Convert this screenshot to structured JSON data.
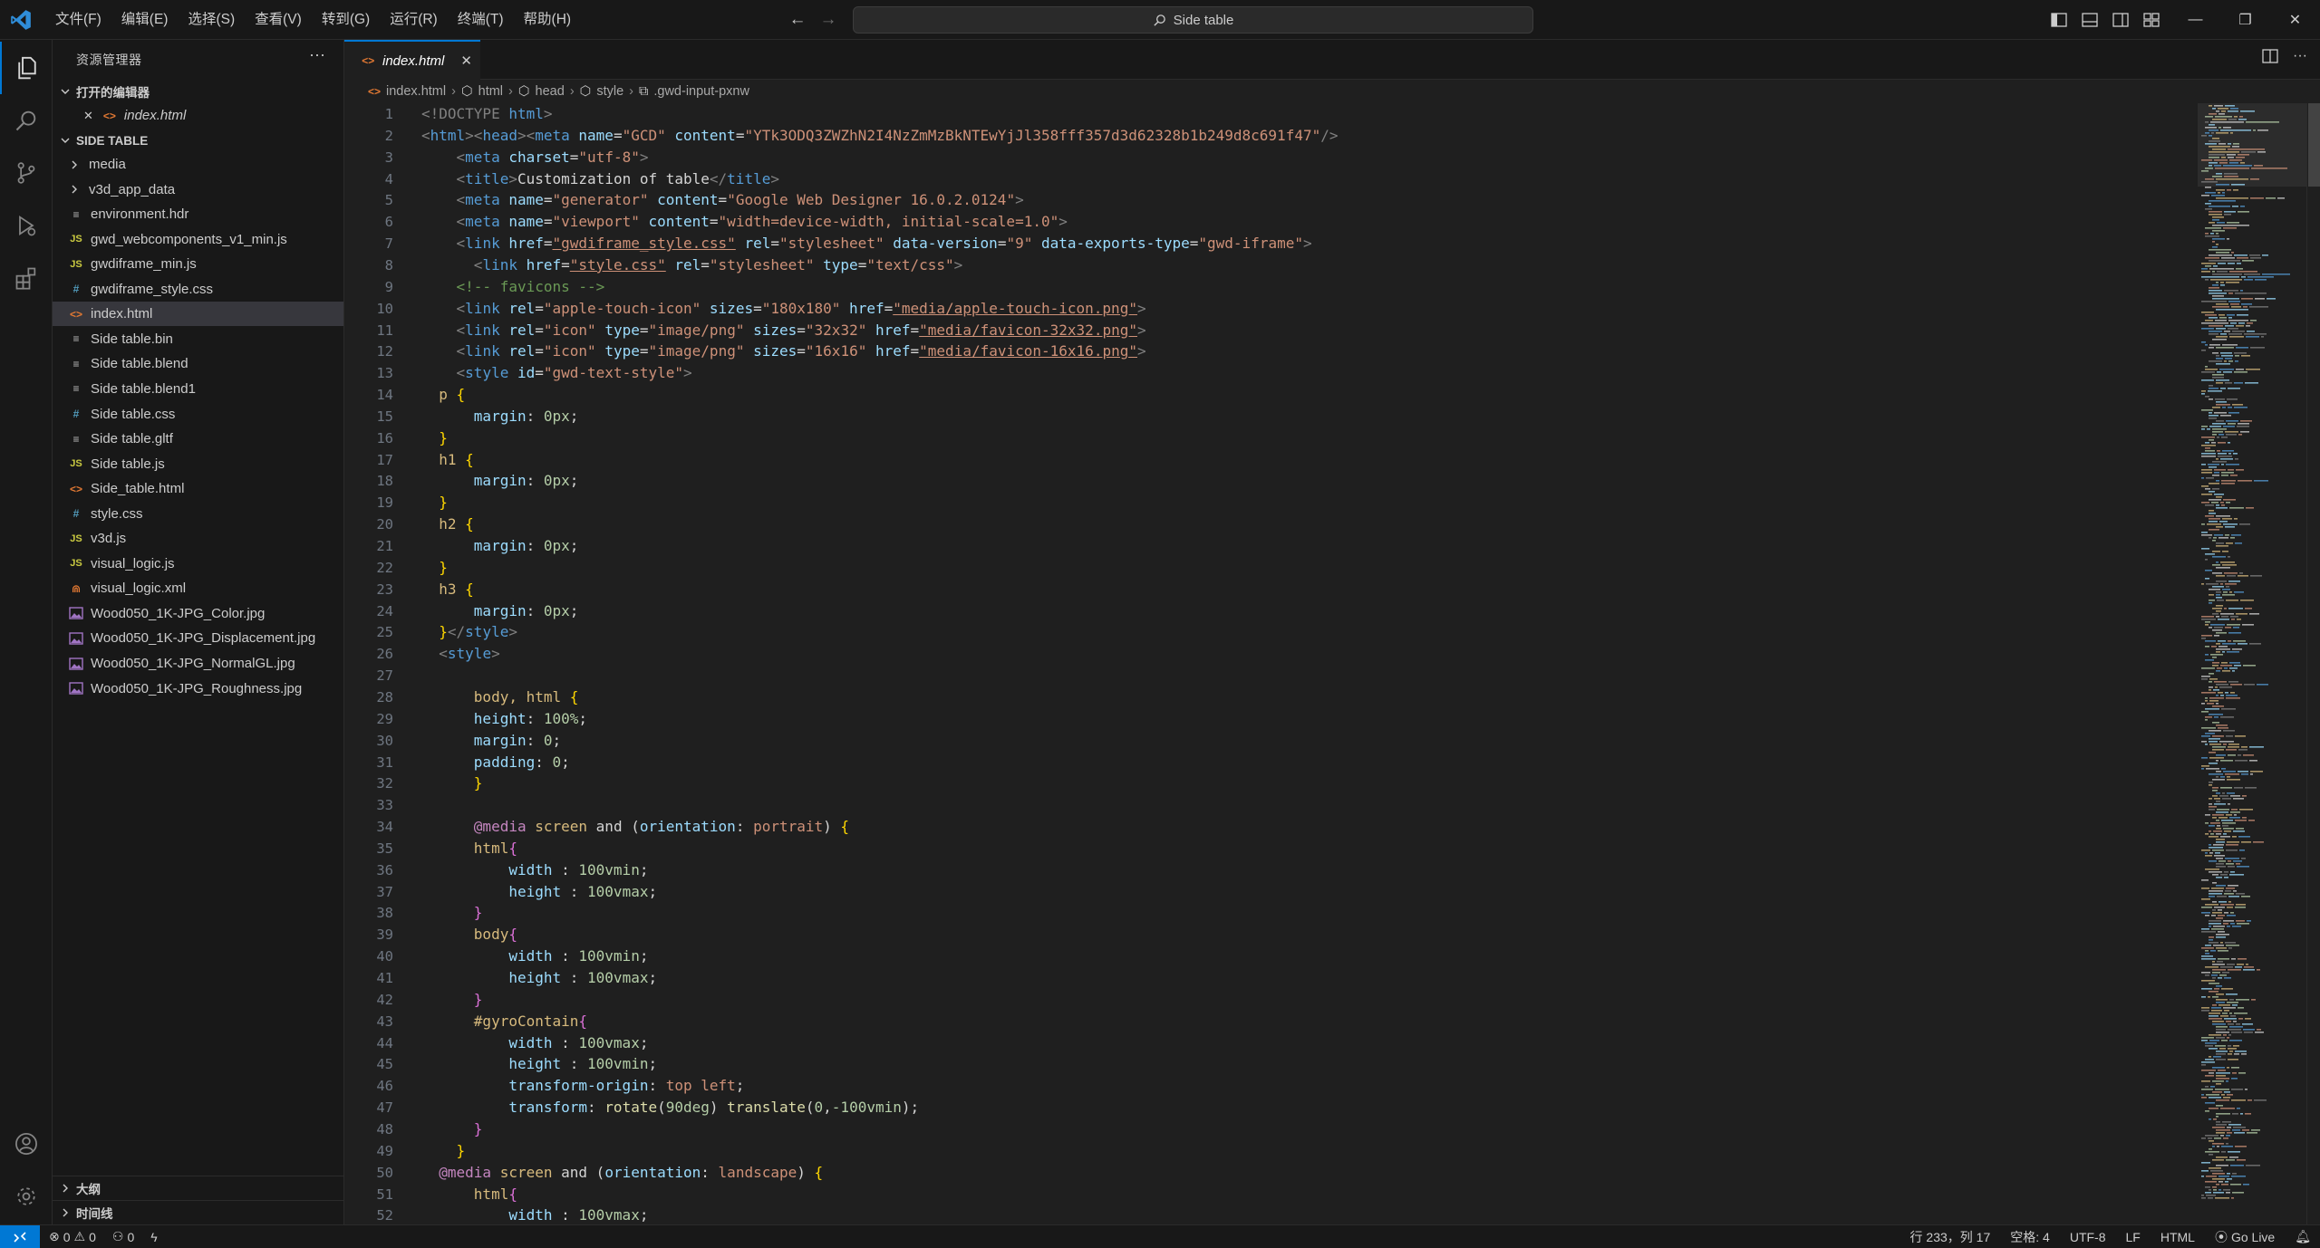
{
  "menu": [
    "文件(F)",
    "编辑(E)",
    "选择(S)",
    "查看(V)",
    "转到(G)",
    "运行(R)",
    "终端(T)",
    "帮助(H)"
  ],
  "search": {
    "text": "Side table"
  },
  "explorer": {
    "title": "资源管理器",
    "open_editors": {
      "title": "打开的编辑器",
      "items": [
        {
          "name": "index.html"
        }
      ]
    },
    "folder": {
      "title": "SIDE TABLE",
      "items": [
        {
          "name": "media",
          "type": "folder"
        },
        {
          "name": "v3d_app_data",
          "type": "folder"
        },
        {
          "name": "environment.hdr",
          "type": "file"
        },
        {
          "name": "gwd_webcomponents_v1_min.js",
          "type": "js"
        },
        {
          "name": "gwdiframe_min.js",
          "type": "js"
        },
        {
          "name": "gwdiframe_style.css",
          "type": "css"
        },
        {
          "name": "index.html",
          "type": "html",
          "selected": true
        },
        {
          "name": "Side table.bin",
          "type": "file"
        },
        {
          "name": "Side table.blend",
          "type": "file"
        },
        {
          "name": "Side table.blend1",
          "type": "file"
        },
        {
          "name": "Side table.css",
          "type": "css"
        },
        {
          "name": "Side table.gltf",
          "type": "file"
        },
        {
          "name": "Side table.js",
          "type": "js"
        },
        {
          "name": "Side_table.html",
          "type": "html"
        },
        {
          "name": "style.css",
          "type": "css"
        },
        {
          "name": "v3d.js",
          "type": "js"
        },
        {
          "name": "visual_logic.js",
          "type": "js"
        },
        {
          "name": "visual_logic.xml",
          "type": "xml"
        },
        {
          "name": "Wood050_1K-JPG_Color.jpg",
          "type": "image"
        },
        {
          "name": "Wood050_1K-JPG_Displacement.jpg",
          "type": "image"
        },
        {
          "name": "Wood050_1K-JPG_NormalGL.jpg",
          "type": "image"
        },
        {
          "name": "Wood050_1K-JPG_Roughness.jpg",
          "type": "image"
        }
      ]
    },
    "outline": {
      "title": "大纲"
    },
    "timeline": {
      "title": "时间线"
    }
  },
  "tab": {
    "label": "index.html"
  },
  "breadcrumb": [
    "index.html",
    "html",
    "head",
    "style",
    ".gwd-input-pxnw"
  ],
  "code_lines": [
    [
      [
        "<!DOCTYPE ",
        "#808080"
      ],
      [
        "html",
        "#569cd6"
      ],
      [
        ">",
        "#808080"
      ]
    ],
    [
      [
        "<",
        "#808080"
      ],
      [
        "html",
        "#569cd6"
      ],
      [
        "><",
        "#808080"
      ],
      [
        "head",
        "#569cd6"
      ],
      [
        "><",
        "#808080"
      ],
      [
        "meta ",
        "#569cd6"
      ],
      [
        "name",
        "#9cdcfe"
      ],
      [
        "=",
        "#d4d4d4"
      ],
      [
        "\"GCD\"",
        "#ce9178"
      ],
      [
        " content",
        "#9cdcfe"
      ],
      [
        "=",
        "#d4d4d4"
      ],
      [
        "\"YTk3ODQ3ZWZhN2I4NzZmMzBkNTEwYjJl358fff357d3d62328b1b249d8c691f47\"",
        "#ce9178"
      ],
      [
        "/>",
        "#808080"
      ]
    ],
    [
      [
        "    <",
        "#808080"
      ],
      [
        "meta ",
        "#569cd6"
      ],
      [
        "charset",
        "#9cdcfe"
      ],
      [
        "=",
        "#d4d4d4"
      ],
      [
        "\"utf-8\"",
        "#ce9178"
      ],
      [
        ">",
        "#808080"
      ]
    ],
    [
      [
        "    <",
        "#808080"
      ],
      [
        "title",
        "#569cd6"
      ],
      [
        ">",
        "#808080"
      ],
      [
        "Customization of table",
        "#d4d4d4"
      ],
      [
        "</",
        "#808080"
      ],
      [
        "title",
        "#569cd6"
      ],
      [
        ">",
        "#808080"
      ]
    ],
    [
      [
        "    <",
        "#808080"
      ],
      [
        "meta ",
        "#569cd6"
      ],
      [
        "name",
        "#9cdcfe"
      ],
      [
        "=",
        "#d4d4d4"
      ],
      [
        "\"generator\"",
        "#ce9178"
      ],
      [
        " content",
        "#9cdcfe"
      ],
      [
        "=",
        "#d4d4d4"
      ],
      [
        "\"Google Web Designer 16.0.2.0124\"",
        "#ce9178"
      ],
      [
        ">",
        "#808080"
      ]
    ],
    [
      [
        "    <",
        "#808080"
      ],
      [
        "meta ",
        "#569cd6"
      ],
      [
        "name",
        "#9cdcfe"
      ],
      [
        "=",
        "#d4d4d4"
      ],
      [
        "\"viewport\"",
        "#ce9178"
      ],
      [
        " content",
        "#9cdcfe"
      ],
      [
        "=",
        "#d4d4d4"
      ],
      [
        "\"width=device-width, initial-scale=1.0\"",
        "#ce9178"
      ],
      [
        ">",
        "#808080"
      ]
    ],
    [
      [
        "    <",
        "#808080"
      ],
      [
        "link ",
        "#569cd6"
      ],
      [
        "href",
        "#9cdcfe"
      ],
      [
        "=",
        "#d4d4d4"
      ],
      [
        "\"gwdiframe_style.css\"",
        "#ce9178"
      ],
      [
        " rel",
        "#9cdcfe"
      ],
      [
        "=",
        "#d4d4d4"
      ],
      [
        "\"stylesheet\"",
        "#ce9178"
      ],
      [
        " data-version",
        "#9cdcfe"
      ],
      [
        "=",
        "#d4d4d4"
      ],
      [
        "\"9\"",
        "#ce9178"
      ],
      [
        " data-exports-type",
        "#9cdcfe"
      ],
      [
        "=",
        "#d4d4d4"
      ],
      [
        "\"gwd-iframe\"",
        "#ce9178"
      ],
      [
        ">",
        "#808080"
      ]
    ],
    [
      [
        "      <",
        "#808080"
      ],
      [
        "link ",
        "#569cd6"
      ],
      [
        "href",
        "#9cdcfe"
      ],
      [
        "=",
        "#d4d4d4"
      ],
      [
        "\"style.css\"",
        "#ce9178"
      ],
      [
        " rel",
        "#9cdcfe"
      ],
      [
        "=",
        "#d4d4d4"
      ],
      [
        "\"stylesheet\"",
        "#ce9178"
      ],
      [
        " type",
        "#9cdcfe"
      ],
      [
        "=",
        "#d4d4d4"
      ],
      [
        "\"text/css\"",
        "#ce9178"
      ],
      [
        ">",
        "#808080"
      ]
    ],
    [
      [
        "    <!-- favicons -->",
        "#6a9955"
      ]
    ],
    [
      [
        "    <",
        "#808080"
      ],
      [
        "link ",
        "#569cd6"
      ],
      [
        "rel",
        "#9cdcfe"
      ],
      [
        "=",
        "#d4d4d4"
      ],
      [
        "\"apple-touch-icon\"",
        "#ce9178"
      ],
      [
        " sizes",
        "#9cdcfe"
      ],
      [
        "=",
        "#d4d4d4"
      ],
      [
        "\"180x180\"",
        "#ce9178"
      ],
      [
        " href",
        "#9cdcfe"
      ],
      [
        "=",
        "#d4d4d4"
      ],
      [
        "\"media/apple-touch-icon.png\"",
        "#ce9178"
      ],
      [
        ">",
        "#808080"
      ]
    ],
    [
      [
        "    <",
        "#808080"
      ],
      [
        "link ",
        "#569cd6"
      ],
      [
        "rel",
        "#9cdcfe"
      ],
      [
        "=",
        "#d4d4d4"
      ],
      [
        "\"icon\"",
        "#ce9178"
      ],
      [
        " type",
        "#9cdcfe"
      ],
      [
        "=",
        "#d4d4d4"
      ],
      [
        "\"image/png\"",
        "#ce9178"
      ],
      [
        " sizes",
        "#9cdcfe"
      ],
      [
        "=",
        "#d4d4d4"
      ],
      [
        "\"32x32\"",
        "#ce9178"
      ],
      [
        " href",
        "#9cdcfe"
      ],
      [
        "=",
        "#d4d4d4"
      ],
      [
        "\"media/favicon-32x32.png\"",
        "#ce9178"
      ],
      [
        ">",
        "#808080"
      ]
    ],
    [
      [
        "    <",
        "#808080"
      ],
      [
        "link ",
        "#569cd6"
      ],
      [
        "rel",
        "#9cdcfe"
      ],
      [
        "=",
        "#d4d4d4"
      ],
      [
        "\"icon\"",
        "#ce9178"
      ],
      [
        " type",
        "#9cdcfe"
      ],
      [
        "=",
        "#d4d4d4"
      ],
      [
        "\"image/png\"",
        "#ce9178"
      ],
      [
        " sizes",
        "#9cdcfe"
      ],
      [
        "=",
        "#d4d4d4"
      ],
      [
        "\"16x16\"",
        "#ce9178"
      ],
      [
        " href",
        "#9cdcfe"
      ],
      [
        "=",
        "#d4d4d4"
      ],
      [
        "\"media/favicon-16x16.png\"",
        "#ce9178"
      ],
      [
        ">",
        "#808080"
      ]
    ],
    [
      [
        "    <",
        "#808080"
      ],
      [
        "style ",
        "#569cd6"
      ],
      [
        "id",
        "#9cdcfe"
      ],
      [
        "=",
        "#d4d4d4"
      ],
      [
        "\"gwd-text-style\"",
        "#ce9178"
      ],
      [
        ">",
        "#808080"
      ]
    ],
    [
      [
        "  p ",
        "#d7ba7d"
      ],
      [
        "{",
        "#ffd700"
      ]
    ],
    [
      [
        "      margin",
        "#9cdcfe"
      ],
      [
        ": ",
        "#d4d4d4"
      ],
      [
        "0px",
        "#b5cea8"
      ],
      [
        ";",
        "#d4d4d4"
      ]
    ],
    [
      [
        "  }",
        "#ffd700"
      ]
    ],
    [
      [
        "  h1 ",
        "#d7ba7d"
      ],
      [
        "{",
        "#ffd700"
      ]
    ],
    [
      [
        "      margin",
        "#9cdcfe"
      ],
      [
        ": ",
        "#d4d4d4"
      ],
      [
        "0px",
        "#b5cea8"
      ],
      [
        ";",
        "#d4d4d4"
      ]
    ],
    [
      [
        "  }",
        "#ffd700"
      ]
    ],
    [
      [
        "  h2 ",
        "#d7ba7d"
      ],
      [
        "{",
        "#ffd700"
      ]
    ],
    [
      [
        "      margin",
        "#9cdcfe"
      ],
      [
        ": ",
        "#d4d4d4"
      ],
      [
        "0px",
        "#b5cea8"
      ],
      [
        ";",
        "#d4d4d4"
      ]
    ],
    [
      [
        "  }",
        "#ffd700"
      ]
    ],
    [
      [
        "  h3 ",
        "#d7ba7d"
      ],
      [
        "{",
        "#ffd700"
      ]
    ],
    [
      [
        "      margin",
        "#9cdcfe"
      ],
      [
        ": ",
        "#d4d4d4"
      ],
      [
        "0px",
        "#b5cea8"
      ],
      [
        ";",
        "#d4d4d4"
      ]
    ],
    [
      [
        "  }",
        "#ffd700"
      ],
      [
        "</",
        "#808080"
      ],
      [
        "style",
        "#569cd6"
      ],
      [
        ">",
        "#808080"
      ]
    ],
    [
      [
        "  <",
        "#808080"
      ],
      [
        "style",
        "#569cd6"
      ],
      [
        ">",
        "#808080"
      ]
    ],
    [
      [
        "",
        "#d4d4d4"
      ]
    ],
    [
      [
        "      body, html ",
        "#d7ba7d"
      ],
      [
        "{",
        "#ffd700"
      ]
    ],
    [
      [
        "      height",
        "#9cdcfe"
      ],
      [
        ": ",
        "#d4d4d4"
      ],
      [
        "100%",
        "#b5cea8"
      ],
      [
        ";",
        "#d4d4d4"
      ]
    ],
    [
      [
        "      margin",
        "#9cdcfe"
      ],
      [
        ": ",
        "#d4d4d4"
      ],
      [
        "0",
        "#b5cea8"
      ],
      [
        ";",
        "#d4d4d4"
      ]
    ],
    [
      [
        "      padding",
        "#9cdcfe"
      ],
      [
        ": ",
        "#d4d4d4"
      ],
      [
        "0",
        "#b5cea8"
      ],
      [
        ";",
        "#d4d4d4"
      ]
    ],
    [
      [
        "      }",
        "#ffd700"
      ]
    ],
    [
      [
        "",
        "#d4d4d4"
      ]
    ],
    [
      [
        "      @media ",
        "#c586c0"
      ],
      [
        "screen ",
        "#d7ba7d"
      ],
      [
        "and ",
        "#d4d4d4"
      ],
      [
        "(",
        "#d4d4d4"
      ],
      [
        "orientation",
        "#9cdcfe"
      ],
      [
        ": ",
        "#d4d4d4"
      ],
      [
        "portrait",
        "#ce9178"
      ],
      [
        ") ",
        "#d4d4d4"
      ],
      [
        "{",
        "#ffd700"
      ]
    ],
    [
      [
        "      html",
        "#d7ba7d"
      ],
      [
        "{",
        "#da70d6"
      ]
    ],
    [
      [
        "          width ",
        "#9cdcfe"
      ],
      [
        ": ",
        "#d4d4d4"
      ],
      [
        "100vmin",
        "#b5cea8"
      ],
      [
        ";",
        "#d4d4d4"
      ]
    ],
    [
      [
        "          height ",
        "#9cdcfe"
      ],
      [
        ": ",
        "#d4d4d4"
      ],
      [
        "100vmax",
        "#b5cea8"
      ],
      [
        ";",
        "#d4d4d4"
      ]
    ],
    [
      [
        "      }",
        "#da70d6"
      ]
    ],
    [
      [
        "      body",
        "#d7ba7d"
      ],
      [
        "{",
        "#da70d6"
      ]
    ],
    [
      [
        "          width ",
        "#9cdcfe"
      ],
      [
        ": ",
        "#d4d4d4"
      ],
      [
        "100vmin",
        "#b5cea8"
      ],
      [
        ";",
        "#d4d4d4"
      ]
    ],
    [
      [
        "          height ",
        "#9cdcfe"
      ],
      [
        ": ",
        "#d4d4d4"
      ],
      [
        "100vmax",
        "#b5cea8"
      ],
      [
        ";",
        "#d4d4d4"
      ]
    ],
    [
      [
        "      }",
        "#da70d6"
      ]
    ],
    [
      [
        "      #gyroContain",
        "#d7ba7d"
      ],
      [
        "{",
        "#da70d6"
      ]
    ],
    [
      [
        "          width ",
        "#9cdcfe"
      ],
      [
        ": ",
        "#d4d4d4"
      ],
      [
        "100vmax",
        "#b5cea8"
      ],
      [
        ";",
        "#d4d4d4"
      ]
    ],
    [
      [
        "          height ",
        "#9cdcfe"
      ],
      [
        ": ",
        "#d4d4d4"
      ],
      [
        "100vmin",
        "#b5cea8"
      ],
      [
        ";",
        "#d4d4d4"
      ]
    ],
    [
      [
        "          transform-origin",
        "#9cdcfe"
      ],
      [
        ": ",
        "#d4d4d4"
      ],
      [
        "top left",
        "#ce9178"
      ],
      [
        ";",
        "#d4d4d4"
      ]
    ],
    [
      [
        "          transform",
        "#9cdcfe"
      ],
      [
        ": ",
        "#d4d4d4"
      ],
      [
        "rotate",
        "#dcdcaa"
      ],
      [
        "(",
        "#d4d4d4"
      ],
      [
        "90deg",
        "#b5cea8"
      ],
      [
        ") ",
        "#d4d4d4"
      ],
      [
        "translate",
        "#dcdcaa"
      ],
      [
        "(",
        "#d4d4d4"
      ],
      [
        "0",
        "#b5cea8"
      ],
      [
        ",",
        "#d4d4d4"
      ],
      [
        "-100vmin",
        "#b5cea8"
      ],
      [
        ");",
        "#d4d4d4"
      ]
    ],
    [
      [
        "      }",
        "#da70d6"
      ]
    ],
    [
      [
        "    }",
        "#ffd700"
      ]
    ],
    [
      [
        "  @media ",
        "#c586c0"
      ],
      [
        "screen ",
        "#d7ba7d"
      ],
      [
        "and ",
        "#d4d4d4"
      ],
      [
        "(",
        "#d4d4d4"
      ],
      [
        "orientation",
        "#9cdcfe"
      ],
      [
        ": ",
        "#d4d4d4"
      ],
      [
        "landscape",
        "#ce9178"
      ],
      [
        ") ",
        "#d4d4d4"
      ],
      [
        "{",
        "#ffd700"
      ]
    ],
    [
      [
        "      html",
        "#d7ba7d"
      ],
      [
        "{",
        "#da70d6"
      ]
    ],
    [
      [
        "          width ",
        "#9cdcfe"
      ],
      [
        ": ",
        "#d4d4d4"
      ],
      [
        "100vmax",
        "#b5cea8"
      ],
      [
        ";",
        "#d4d4d4"
      ]
    ]
  ],
  "status": {
    "errors": "0",
    "warnings": "0",
    "ports": "0",
    "position": "行 233，列 17",
    "spaces": "空格: 4",
    "encoding": "UTF-8",
    "eol": "LF",
    "language": "HTML",
    "go_live": "Go Live"
  },
  "colors": {
    "accent": "#0078d4",
    "background": "#1f1f1f",
    "chrome": "#181818"
  }
}
